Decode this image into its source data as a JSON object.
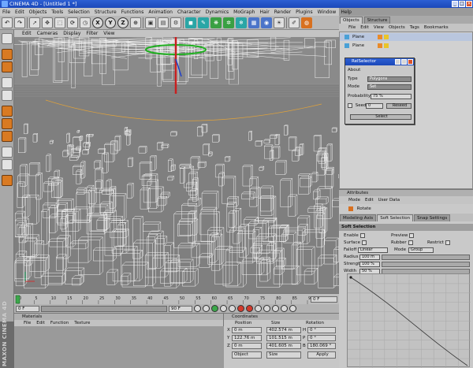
{
  "app": {
    "title": "CINEMA 4D - [Untitled 1 *]",
    "brand": "MAXON CINEMA 4D"
  },
  "menus": {
    "main": [
      "File",
      "Edit",
      "Objects",
      "Tools",
      "Selection",
      "Structure",
      "Functions",
      "Animation",
      "Character",
      "Dynamics",
      "MoGraph",
      "Hair",
      "Render",
      "Plugins",
      "Window",
      "Help"
    ],
    "viewport": [
      "Edit",
      "Cameras",
      "Display",
      "Filter",
      "View"
    ],
    "objects": [
      "File",
      "Edit",
      "View",
      "Objects",
      "Tags",
      "Bookmarks"
    ],
    "attributes": [
      "Mode",
      "Edit",
      "User Data"
    ],
    "material": [
      "File",
      "Edit",
      "Function",
      "Texture"
    ]
  },
  "toolbar": {
    "axis_labels": [
      "X",
      "Y",
      "Z"
    ]
  },
  "panels": {
    "objects_tabs": [
      "Objects",
      "Structure"
    ],
    "objects_rows": [
      {
        "name": "Plane"
      },
      {
        "name": "Plane"
      }
    ],
    "material_title": "Materials",
    "coordinates_title": "Coordinates",
    "attributes_title": "Attributes"
  },
  "timeline": {
    "ticks": [
      "0",
      "5",
      "10",
      "15",
      "20",
      "25",
      "30",
      "35",
      "40",
      "45",
      "50",
      "55",
      "60",
      "65",
      "70",
      "75",
      "80",
      "85",
      "90"
    ],
    "end_frame": "0 F",
    "start_field": "0 F",
    "end_field": "90 F"
  },
  "coordinates": {
    "headers": [
      "Position",
      "Size",
      "Rotation"
    ],
    "rows": [
      {
        "axis": "X",
        "pos": "0 m",
        "size": "402.574 m",
        "rot_label": "H",
        "rot": "0 °"
      },
      {
        "axis": "Y",
        "pos": "122.76 m",
        "size": "101.515 m",
        "rot_label": "P",
        "rot": "0 °"
      },
      {
        "axis": "Z",
        "pos": "0 m",
        "size": "401.605 m",
        "rot_label": "B",
        "rot": "180.069 °"
      }
    ],
    "mode_select": "Object",
    "size_select": "Size",
    "apply_label": "Apply"
  },
  "relselector": {
    "title": "RelSelector",
    "about_label": "About",
    "type_label": "Type",
    "type_value": "Polygons",
    "mode_label": "Mode",
    "mode_value": "Set",
    "prob_label": "Probability",
    "prob_value": "75 %",
    "seed_label": "Seed",
    "seed_value": "0",
    "reseed_label": "Reseed",
    "select_label": "Select"
  },
  "attributes": {
    "object_name": "Rotate",
    "tabs": [
      "Modeling Axis",
      "Soft Selection",
      "Snap Settings"
    ],
    "active_tab": "Soft Selection",
    "section_title": "Soft Selection",
    "enable_label": "Enable",
    "preview_label": "Preview",
    "surface_label": "Surface",
    "rubber_label": "Rubber",
    "restrict_label": "Restrict",
    "falloff_label": "Falloff",
    "falloff_value": "Linear",
    "mode_label": "Mode",
    "mode_value": "Group",
    "radius_label": "Radius",
    "radius_value": "100 m",
    "strength_label": "Strength",
    "strength_value": "100 %",
    "width_label": "Width",
    "width_value": "50 %"
  },
  "colors": {
    "viewport_bg": "#7f7f7f",
    "wire": "#ffffff",
    "accent_orange": "#d8701f",
    "title_blue": "#1f4fc4"
  }
}
